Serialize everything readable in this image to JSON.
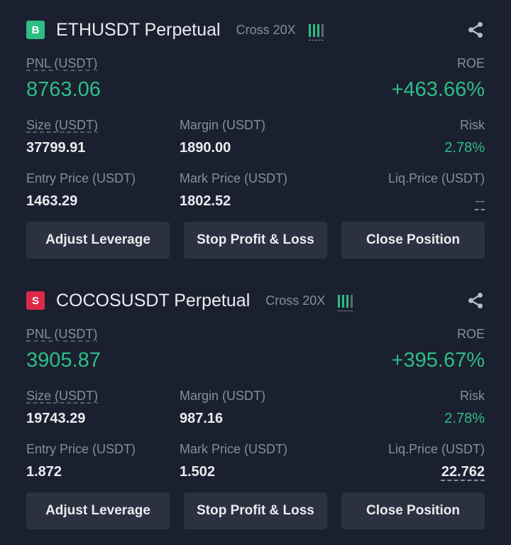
{
  "positions": [
    {
      "side": "B",
      "symbol": "ETHUSDT Perpetual",
      "margin_mode": "Cross 20X",
      "pnl_label": "PNL (USDT)",
      "pnl": "8763.06",
      "roe_label": "ROE",
      "roe": "+463.66%",
      "size_label": "Size (USDT)",
      "size": "37799.91",
      "margin_label": "Margin (USDT)",
      "margin": "1890.00",
      "risk_label": "Risk",
      "risk": "2.78%",
      "entry_label": "Entry Price (USDT)",
      "entry": "1463.29",
      "mark_label": "Mark Price (USDT)",
      "mark": "1802.52",
      "liq_label": "Liq.Price (USDT)",
      "liq": "--",
      "buttons": {
        "leverage": "Adjust Leverage",
        "tpsl": "Stop Profit & Loss",
        "close": "Close Position"
      }
    },
    {
      "side": "S",
      "symbol": "COCOSUSDT Perpetual",
      "margin_mode": "Cross 20X",
      "pnl_label": "PNL (USDT)",
      "pnl": "3905.87",
      "roe_label": "ROE",
      "roe": "+395.67%",
      "size_label": "Size (USDT)",
      "size": "19743.29",
      "margin_label": "Margin (USDT)",
      "margin": "987.16",
      "risk_label": "Risk",
      "risk": "2.78%",
      "entry_label": "Entry Price (USDT)",
      "entry": "1.872",
      "mark_label": "Mark Price (USDT)",
      "mark": "1.502",
      "liq_label": "Liq.Price (USDT)",
      "liq": "22.762",
      "buttons": {
        "leverage": "Adjust Leverage",
        "tpsl": "Stop Profit & Loss",
        "close": "Close Position"
      }
    }
  ],
  "colors": {
    "background": "#1b2030",
    "profit": "#2ebd85",
    "buy_badge": "#2ebd85",
    "sell_badge": "#e0294a",
    "button_bg": "#2b3140"
  },
  "icons": {
    "share": "share-icon",
    "leverage_bars": "leverage-bars-icon"
  }
}
